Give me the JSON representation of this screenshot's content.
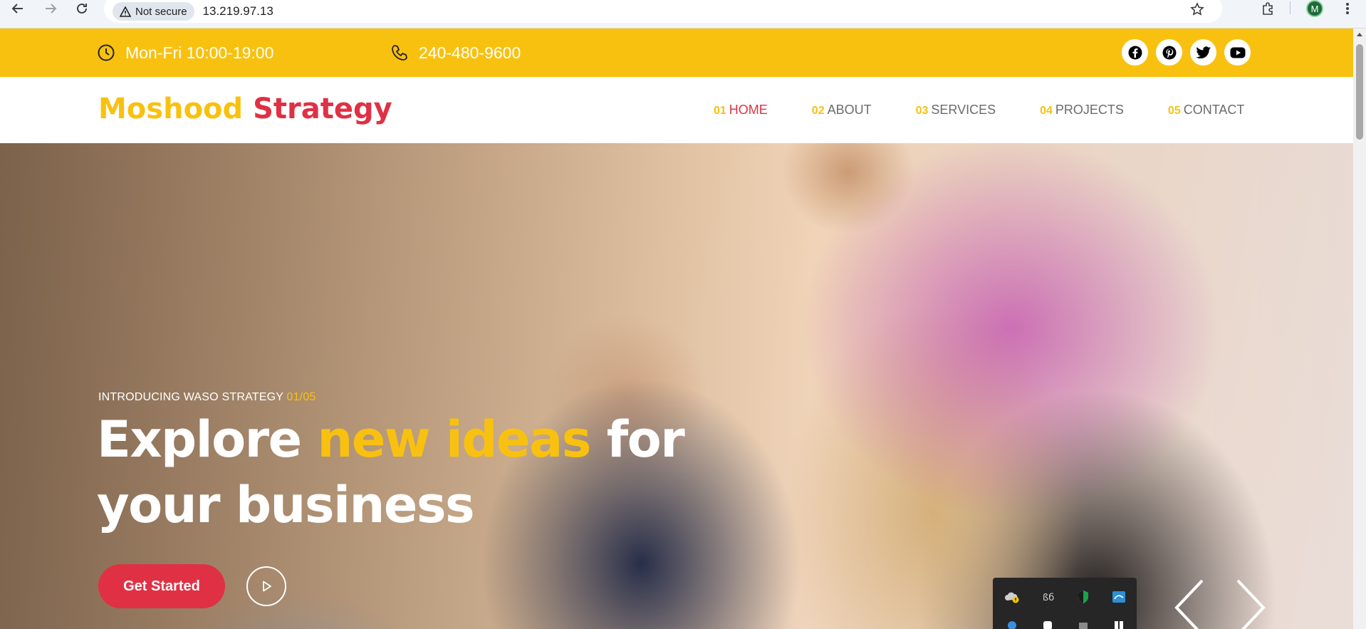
{
  "browser": {
    "security_label": "Not secure",
    "url": "13.219.97.13",
    "profile_initial": "M"
  },
  "topbar": {
    "hours": "Mon-Fri 10:00-19:00",
    "phone": "240-480-9600",
    "socials": [
      "facebook",
      "pinterest",
      "twitter",
      "youtube"
    ]
  },
  "header": {
    "logo_part1": "Moshood",
    "logo_part2": "Strategy",
    "nav": [
      {
        "num": "01",
        "label": "HOME",
        "active": true
      },
      {
        "num": "02",
        "label": "ABOUT",
        "active": false
      },
      {
        "num": "03",
        "label": "SERVICES",
        "active": false
      },
      {
        "num": "04",
        "label": "PROJECTS",
        "active": false
      },
      {
        "num": "05",
        "label": "CONTACT",
        "active": false
      }
    ]
  },
  "hero": {
    "eyebrow": "INTRODUCING WASO STRATEGY",
    "slide_count": "01/05",
    "title_part1": "Explore ",
    "title_highlight": "new ideas",
    "title_part2": " for your business",
    "cta_label": "Get Started"
  },
  "colors": {
    "accent_yellow": "#f9c10f",
    "accent_red": "#e03144"
  }
}
